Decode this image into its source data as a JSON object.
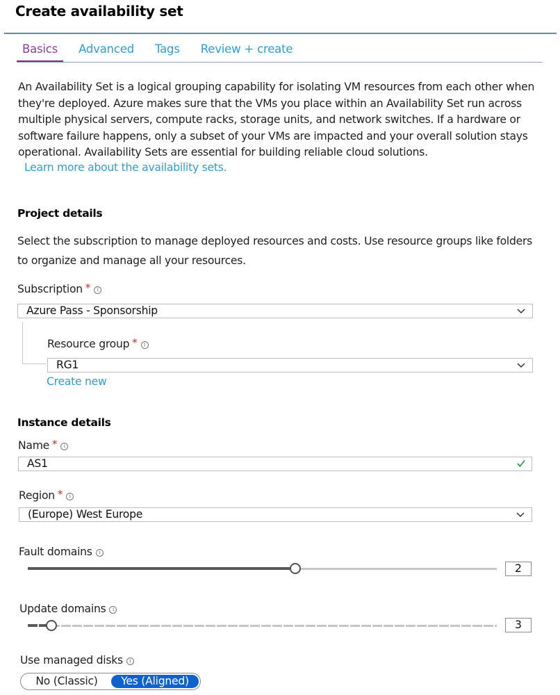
{
  "page": {
    "title": "Create availability set"
  },
  "tabs": [
    {
      "label": "Basics",
      "active": true
    },
    {
      "label": "Advanced",
      "active": false
    },
    {
      "label": "Tags",
      "active": false
    },
    {
      "label": "Review + create",
      "active": false
    }
  ],
  "intro": {
    "text": "An Availability Set is a logical grouping capability for isolating VM resources from each other when they're deployed. Azure makes sure that the VMs you place within an Availability Set run across multiple physical servers, compute racks, storage units, and network switches. If a hardware or software failure happens, only a subset of your VMs are impacted and your overall solution stays operational. Availability Sets are essential for building reliable cloud solutions.",
    "learn_more": "Learn more about the availability sets."
  },
  "project_details": {
    "heading": "Project details",
    "description": "Select the subscription to manage deployed resources and costs. Use resource groups like folders to organize and manage all your resources.",
    "subscription": {
      "label": "Subscription",
      "required_mark": "*",
      "info_icon": "info-icon",
      "value": "Azure Pass - Sponsorship"
    },
    "resource_group": {
      "label": "Resource group",
      "required_mark": "*",
      "info_icon": "info-icon",
      "value": "RG1",
      "create_new": "Create new"
    }
  },
  "instance_details": {
    "heading": "Instance details",
    "name": {
      "label": "Name",
      "required_mark": "*",
      "value": "AS1",
      "valid_icon": "checkmark-icon",
      "valid_color": "#2e9e3e"
    },
    "region": {
      "label": "Region",
      "required_mark": "*",
      "value": "(Europe) West Europe"
    },
    "fault_domains": {
      "label": "Fault domains",
      "value": "2",
      "min": 1,
      "max": 3,
      "fill_fraction": 0.57
    },
    "update_domains": {
      "label": "Update domains",
      "value": "3",
      "min": 1,
      "max": 20,
      "fill_fraction": 0.05
    },
    "managed_disks": {
      "label": "Use managed disks",
      "options": [
        "No (Classic)",
        "Yes (Aligned)"
      ],
      "selected": "Yes (Aligned)"
    }
  },
  "colors": {
    "accent_tab": "#7b2f8c",
    "link": "#2e9fd4",
    "required": "#d8262c",
    "toggle_selected": "#0e61d1",
    "valid": "#2e9e3e"
  }
}
